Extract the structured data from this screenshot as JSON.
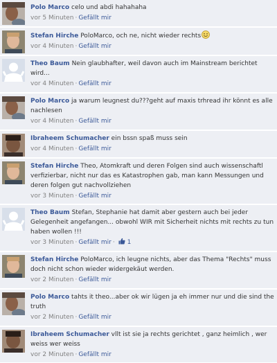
{
  "actions": {
    "like_label": "Gefällt mir",
    "separator": "·"
  },
  "colors": {
    "background": "#edeff4",
    "link": "#3b5998",
    "meta": "#808080",
    "text": "#333333"
  },
  "comments": [
    {
      "author": "Polo Marco",
      "text": "celo und abdi hahahaha",
      "time": "vor 5 Minuten",
      "avatar": "polo-marco-avatar"
    },
    {
      "author": "Stefan Hirche",
      "text": "PoloMarco, och ne, nicht wieder rechts",
      "emoticon": "smiley-emoticon",
      "time": "vor 4 Minuten",
      "avatar": "stefan-hirche-avatar"
    },
    {
      "author": "Theo Baum",
      "text": "Nein glaubhafter, weil davon auch im Mainstream berichtet wird...",
      "time": "vor 4 Minuten",
      "avatar": "default-silhouette-avatar"
    },
    {
      "author": "Polo Marco",
      "text": "ja warum leugnest du???geht auf maxis trhread ihr könnt es alle nachlesen",
      "time": "vor 4 Minuten",
      "avatar": "polo-marco-avatar"
    },
    {
      "author": "Ibraheem Schumacher",
      "text": "ein bssn spaß muss sein",
      "time": "vor 4 Minuten",
      "avatar": "ibraheem-schumacher-avatar"
    },
    {
      "author": "Stefan Hirche",
      "text": "Theo, Atomkraft und deren Folgen sind auch wissenschaftl verfizierbar, nicht nur das es Katastrophen gab, man kann Messungen und deren folgen gut nachvollziehen",
      "time": "vor 3 Minuten",
      "avatar": "stefan-hirche-avatar"
    },
    {
      "author": "Theo Baum",
      "text": "Stefan, Stephanie hat damit aber gestern auch bei jeder Gelegenheit angefangen... obwohl WIR mit Sicherheit nichts mit rechts zu tun haben wollen !!!",
      "time": "vor 3 Minuten",
      "like_count": "1",
      "avatar": "default-silhouette-avatar"
    },
    {
      "author": "Stefan Hirche",
      "text": "PoloMarco, ich leugne nichts, aber das Thema \"Rechts\" muss doch nicht schon wieder widergekäut werden.",
      "time": "vor 2 Minuten",
      "avatar": "stefan-hirche-avatar"
    },
    {
      "author": "Polo Marco",
      "text": "tahts it theo...aber ok wir lügen ja eh immer nur und die sind the truth",
      "time": "vor 2 Minuten",
      "avatar": "polo-marco-avatar"
    },
    {
      "author": "Ibraheem Schumacher",
      "text": "vllt ist sie ja rechts gerichtet , ganz heimlich , wer weiss wer weiss",
      "time": "vor 2 Minuten",
      "avatar": "ibraheem-schumacher-avatar"
    }
  ]
}
